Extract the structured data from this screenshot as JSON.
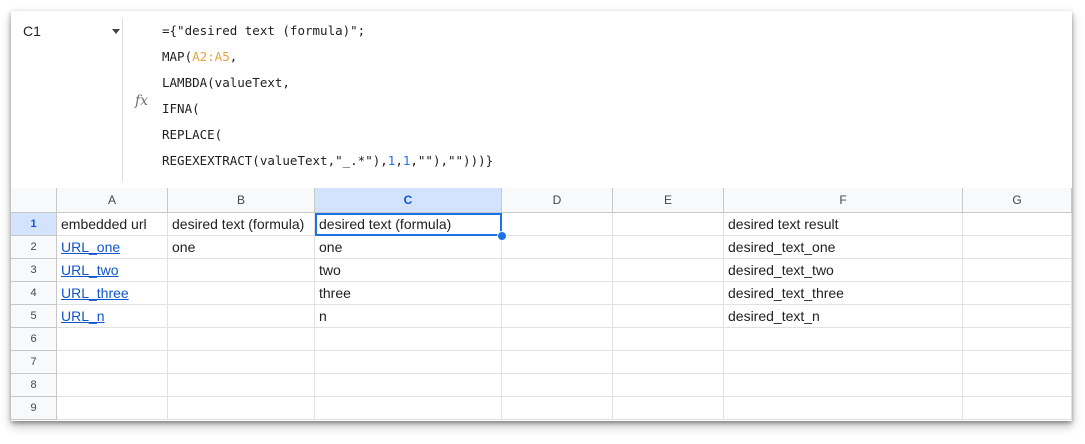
{
  "name_box": {
    "ref": "C1"
  },
  "formula_bar": {
    "fx_label": "fx",
    "lines": [
      [
        {
          "t": "={\"desired text (formula)\";",
          "c": ""
        }
      ],
      [
        {
          "t": "MAP(",
          "c": ""
        },
        {
          "t": "A2:A5",
          "c": "rng"
        },
        {
          "t": ",",
          "c": ""
        }
      ],
      [
        {
          "t": "LAMBDA(valueText,",
          "c": ""
        }
      ],
      [
        {
          "t": "IFNA(",
          "c": ""
        }
      ],
      [
        {
          "t": "REPLACE(",
          "c": ""
        }
      ],
      [
        {
          "t": "REGEXEXTRACT(valueText,\"_.*\"),",
          "c": ""
        },
        {
          "t": "1",
          "c": "num"
        },
        {
          "t": ",",
          "c": ""
        },
        {
          "t": "1",
          "c": "num"
        },
        {
          "t": ",\"\"),\"\")))}",
          "c": ""
        }
      ]
    ]
  },
  "columns": [
    "A",
    "B",
    "C",
    "D",
    "E",
    "F",
    "G"
  ],
  "selected_column": "C",
  "selected_row": "1",
  "rows": [
    {
      "num": "1",
      "cells": {
        "A": "embedded url",
        "B": "desired text (formula)",
        "C": "desired text (formula)",
        "D": "",
        "E": "",
        "F": "desired text result",
        "G": ""
      }
    },
    {
      "num": "2",
      "cells": {
        "A": "URL_one",
        "B": "one",
        "C": "one",
        "D": "",
        "E": "",
        "F": "desired_text_one",
        "G": ""
      }
    },
    {
      "num": "3",
      "cells": {
        "A": "URL_two",
        "B": "",
        "C": "two",
        "D": "",
        "E": "",
        "F": "desired_text_two",
        "G": ""
      }
    },
    {
      "num": "4",
      "cells": {
        "A": "URL_three",
        "B": "",
        "C": "three",
        "D": "",
        "E": "",
        "F": "desired_text_three",
        "G": ""
      }
    },
    {
      "num": "5",
      "cells": {
        "A": "URL_n",
        "B": "",
        "C": "n",
        "D": "",
        "E": "",
        "F": "desired_text_n",
        "G": ""
      }
    },
    {
      "num": "6",
      "cells": {
        "A": "",
        "B": "",
        "C": "",
        "D": "",
        "E": "",
        "F": "",
        "G": ""
      }
    },
    {
      "num": "7",
      "cells": {
        "A": "",
        "B": "",
        "C": "",
        "D": "",
        "E": "",
        "F": "",
        "G": ""
      }
    },
    {
      "num": "8",
      "cells": {
        "A": "",
        "B": "",
        "C": "",
        "D": "",
        "E": "",
        "F": "",
        "G": ""
      }
    },
    {
      "num": "9",
      "cells": {
        "A": "",
        "B": "",
        "C": "",
        "D": "",
        "E": "",
        "F": "",
        "G": ""
      }
    }
  ],
  "link_cells": [
    "A2",
    "A3",
    "A4",
    "A5"
  ],
  "colors": {
    "link": "#1155cc",
    "selection": "#1a73e8",
    "range_highlight": "#e8a33d",
    "number": "#1a73e8"
  }
}
